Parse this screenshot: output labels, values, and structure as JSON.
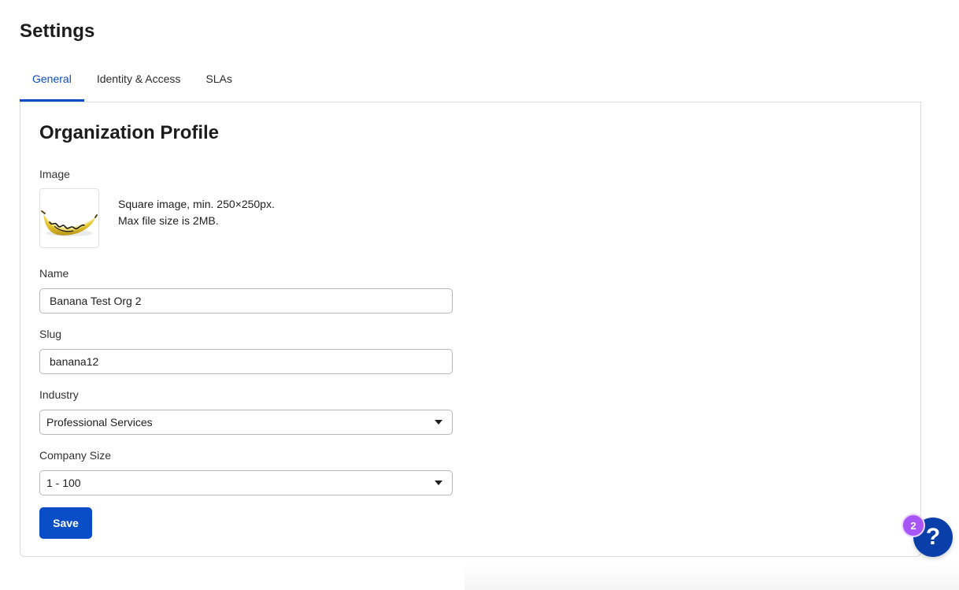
{
  "page": {
    "title": "Settings"
  },
  "tabs": [
    {
      "label": "General",
      "active": true
    },
    {
      "label": "Identity & Access",
      "active": false
    },
    {
      "label": "SLAs",
      "active": false
    }
  ],
  "profile": {
    "title": "Organization Profile",
    "image": {
      "label": "Image",
      "help_line1": "Square image, min. 250×250px.",
      "help_line2": "Max file size is 2MB.",
      "icon": "banana-logo"
    },
    "name": {
      "label": "Name",
      "value": "Banana Test Org 2"
    },
    "slug": {
      "label": "Slug",
      "value": "banana12"
    },
    "industry": {
      "label": "Industry",
      "value": "Professional Services"
    },
    "company_size": {
      "label": "Company Size",
      "value": "1 - 100"
    },
    "save_label": "Save"
  },
  "help": {
    "icon": "question-mark-icon",
    "glyph": "?",
    "badge_count": "2"
  },
  "colors": {
    "accent": "#0a4ec7",
    "help_button": "#0a3ea8",
    "badge": "#a855f7"
  }
}
